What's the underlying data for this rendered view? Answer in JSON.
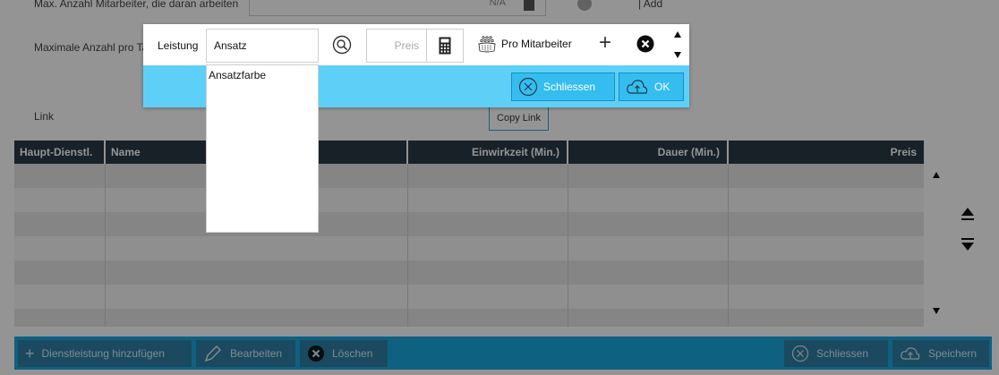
{
  "form": {
    "max_workers_label": "Max. Anzahl Mitarbeiter, die daran arbeiten",
    "max_workers_value": "N/A",
    "add_label": "Add",
    "max_parallel_label": "Maximale Anzahl pro Tag",
    "link_label": "Link",
    "copy_link_label": "Copy Link"
  },
  "table": {
    "columns": [
      "Haupt-Dienstl.",
      "Name",
      "Einwirkzeit (Min.)",
      "Dauer (Min.)",
      "Preis"
    ],
    "rows": 7
  },
  "toolbar": {
    "add_service": "Dienstleistung hinzufügen",
    "edit": "Bearbeiten",
    "delete": "Löschen",
    "close": "Schliessen",
    "save": "Speichern"
  },
  "dialog": {
    "service_label": "Leistung",
    "service_value": "Ansatz",
    "price_placeholder": "Preis",
    "per_worker_label": "Pro Mitarbeiter",
    "close_label": "Schliessen",
    "ok_label": "OK",
    "suggestions": [
      "Ansatzfarbe"
    ]
  },
  "colors": {
    "accent": "#1aa8e0",
    "dialog_footer": "#5ed0f8",
    "table_header": "#2c3a45"
  }
}
